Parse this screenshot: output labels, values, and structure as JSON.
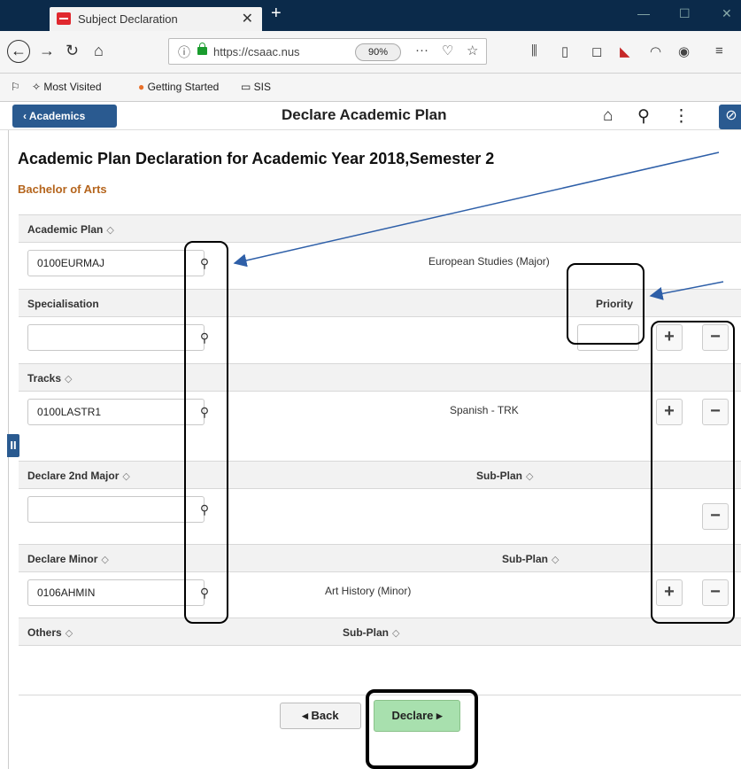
{
  "browser": {
    "tab_title": "Subject Declaration",
    "url": "https://csaac.nus",
    "zoom": "90%",
    "bookmarks": [
      "Most Visited",
      "Getting Started",
      "SIS"
    ]
  },
  "app": {
    "back_label": "Academics",
    "title": "Declare Academic Plan"
  },
  "page": {
    "title": "Academic Plan Declaration for Academic Year 2018,Semester 2",
    "degree": "Bachelor of Arts"
  },
  "sections": {
    "academic_plan": {
      "label": "Academic Plan",
      "value": "0100EURMAJ",
      "description": "European Studies (Major)"
    },
    "specialisation": {
      "label": "Specialisation",
      "priority_label": "Priority",
      "value": ""
    },
    "tracks": {
      "label": "Tracks",
      "value": "0100LASTR1",
      "description": "Spanish - TRK"
    },
    "second_major": {
      "label": "Declare 2nd Major",
      "subplan_label": "Sub-Plan",
      "value": ""
    },
    "minor": {
      "label": "Declare Minor",
      "subplan_label": "Sub-Plan",
      "value": "0106AHMIN",
      "description": "Art History (Minor)"
    },
    "others": {
      "label": "Others",
      "subplan_label": "Sub-Plan"
    }
  },
  "buttons": {
    "back": "Back",
    "declare": "Declare"
  },
  "colors": {
    "accent": "#2a5a90",
    "declare_green": "#a8e0ae",
    "degree_orange": "#b5651d"
  }
}
